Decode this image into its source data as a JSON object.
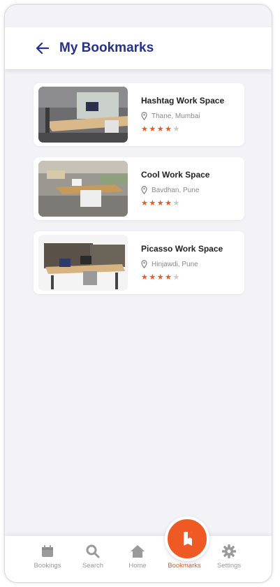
{
  "header": {
    "title": "My Bookmarks"
  },
  "bookmarks": [
    {
      "name": "Hashtag Work Space",
      "location": "Thane, Mumbai",
      "rating": 4,
      "max_rating": 5
    },
    {
      "name": "Cool Work Space",
      "location": "Bavdhan, Pune",
      "rating": 4,
      "max_rating": 5
    },
    {
      "name": "Picasso Work Space",
      "location": "Hinjawdi, Pune",
      "rating": 4,
      "max_rating": 5
    }
  ],
  "nav": {
    "items": [
      {
        "label": "Bookings",
        "icon": "calendar-icon"
      },
      {
        "label": "Search",
        "icon": "search-icon"
      },
      {
        "label": "Home",
        "icon": "home-icon"
      },
      {
        "label": "Bookmarks",
        "icon": "bookmark-icon"
      },
      {
        "label": "Settings",
        "icon": "gear-icon"
      }
    ],
    "active": "Bookmarks"
  },
  "colors": {
    "accent": "#ef5a24",
    "title": "#26318a",
    "background": "#f2f2f7"
  }
}
